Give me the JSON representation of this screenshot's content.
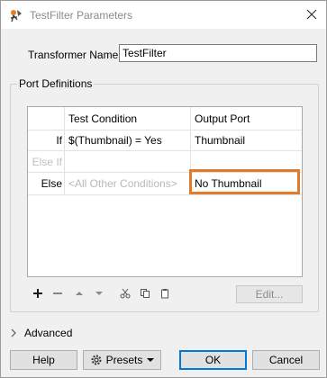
{
  "window": {
    "title": "TestFilter Parameters"
  },
  "transformer": {
    "label": "Transformer Name:",
    "value": "TestFilter"
  },
  "port_definitions": {
    "group_title": "Port Definitions",
    "headers": {
      "condition": "Test Condition",
      "output": "Output Port"
    },
    "rows": [
      {
        "label": "If",
        "condition": "$(Thumbnail) = Yes",
        "output": "Thumbnail"
      },
      {
        "label": "Else If",
        "condition": "",
        "output": ""
      },
      {
        "label": "Else",
        "condition": "<All Other Conditions>",
        "output": "No Thumbnail"
      }
    ],
    "edit_label": "Edit..."
  },
  "advanced": {
    "label": "Advanced"
  },
  "buttons": {
    "help": "Help",
    "presets": "Presets",
    "ok": "OK",
    "cancel": "Cancel"
  },
  "colors": {
    "highlight": "#e37a2a",
    "ok_border": "#0078d7"
  }
}
